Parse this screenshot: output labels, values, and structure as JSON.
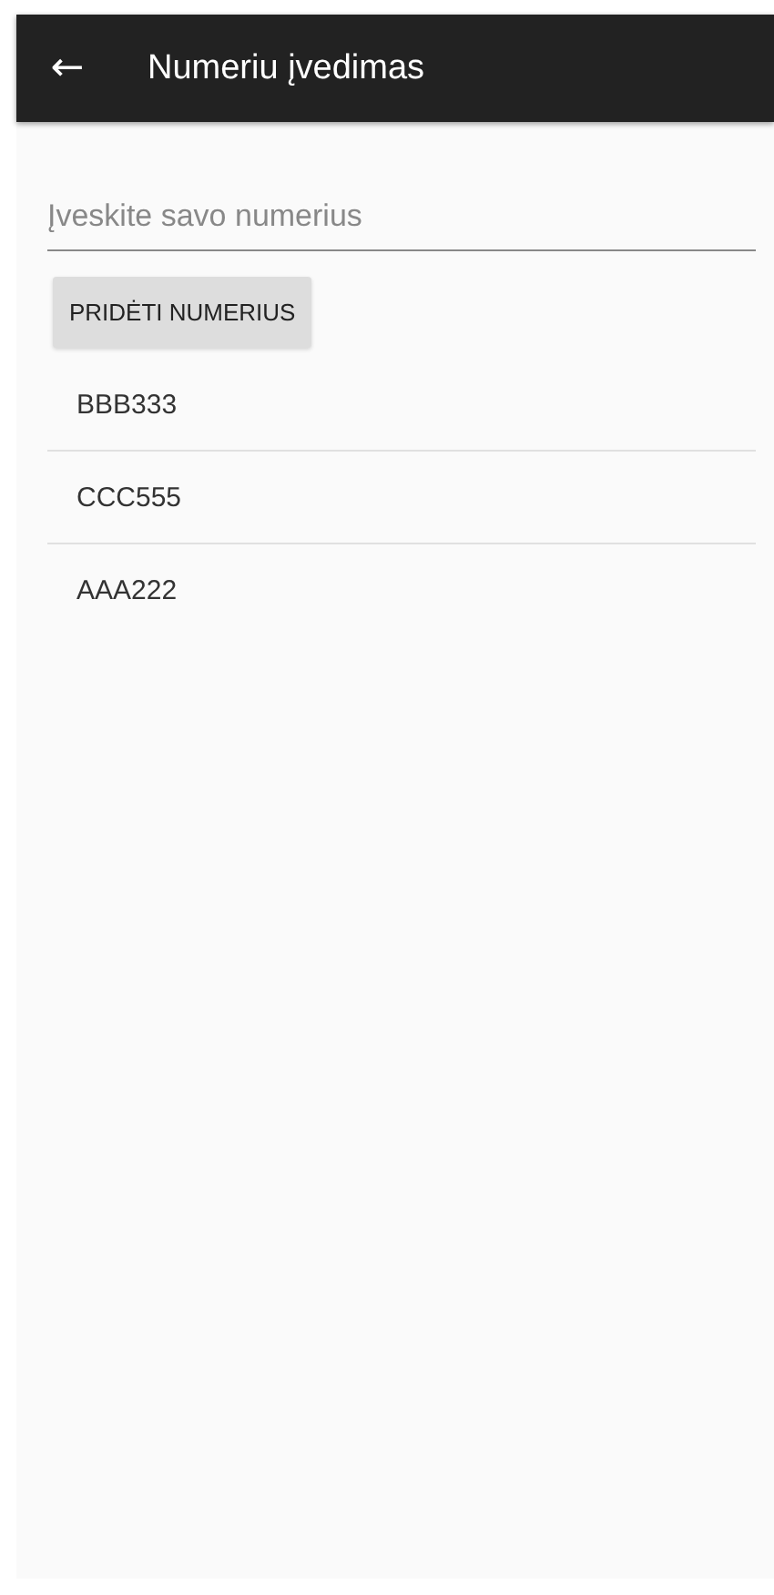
{
  "app_bar": {
    "back": "←",
    "title": "Numeriu įvedimas"
  },
  "input": {
    "placeholder": "Įveskite savo numerius"
  },
  "add_button": "PRIDĖTI NUMERIUS",
  "numbers": [
    "BBB333",
    "CCC555",
    "AAA222"
  ]
}
